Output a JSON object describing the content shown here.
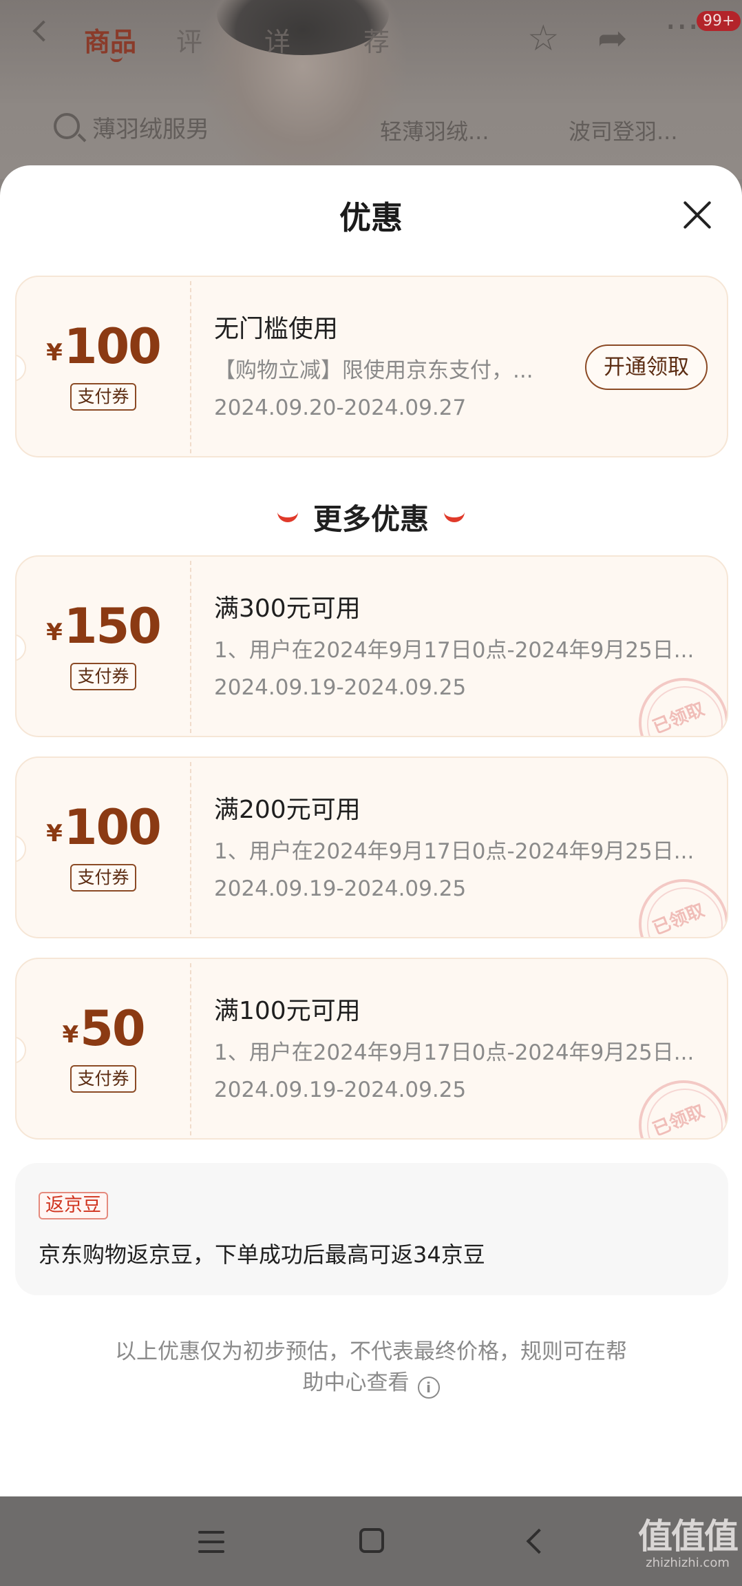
{
  "background_page": {
    "tabs": [
      "商品",
      "评",
      "详",
      "荐"
    ],
    "badge": "99+",
    "search_text": "薄羽绒服男",
    "chips": [
      "轻薄羽绒...",
      "波司登羽..."
    ]
  },
  "sheet": {
    "title": "优惠"
  },
  "main_coupon": {
    "yen": "¥",
    "amount": "100",
    "tag": "支付券",
    "title": "无门槛使用",
    "desc": "【购物立减】限使用京东支付，...",
    "date": "2024.09.20-2024.09.27",
    "button": "开通领取"
  },
  "more_header": "更多优惠",
  "coupons": [
    {
      "yen": "¥",
      "amount": "150",
      "tag": "支付券",
      "title": "满300元可用",
      "desc": "1、用户在2024年9月17日0点-2024年9月25日...",
      "date": "2024.09.19-2024.09.25",
      "stamp": "已领取"
    },
    {
      "yen": "¥",
      "amount": "100",
      "tag": "支付券",
      "title": "满200元可用",
      "desc": "1、用户在2024年9月17日0点-2024年9月25日...",
      "date": "2024.09.19-2024.09.25",
      "stamp": "已领取"
    },
    {
      "yen": "¥",
      "amount": "50",
      "tag": "支付券",
      "title": "满100元可用",
      "desc": "1、用户在2024年9月17日0点-2024年9月25日...",
      "date": "2024.09.19-2024.09.25",
      "stamp": "已领取"
    }
  ],
  "jd_bean": {
    "tag": "返京豆",
    "text": "京东购物返京豆，下单成功后最高可返34京豆"
  },
  "disclaimer": {
    "line1": "以上优惠仅为初步预估，不代表最终价格，规则可在帮",
    "line2": "助中心查看"
  },
  "watermark": {
    "logo": "值值值",
    "url": "zhizhizhi.com"
  },
  "colors": {
    "accent_brown": "#8b3a13",
    "accent_red": "#e03a2a",
    "card_bg": "#fef8f2"
  }
}
